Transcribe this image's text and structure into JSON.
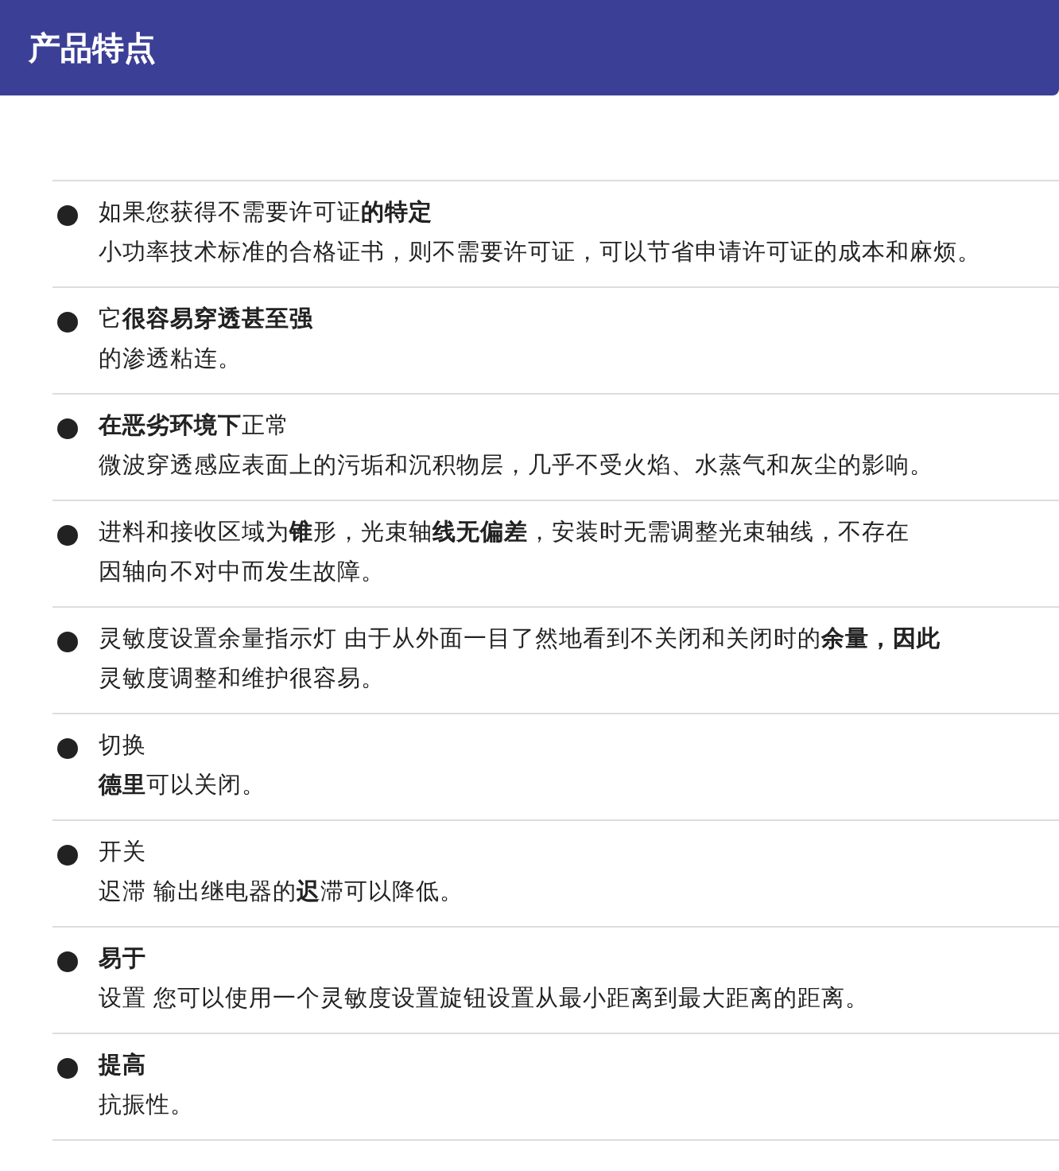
{
  "header": {
    "title": "产品特点"
  },
  "features": [
    {
      "lines": [
        "如果您获得不需要许可证**的特定**",
        "小功率技术标准的合格证书，则不需要许可证，可以节省申请许可证的成本和麻烦。"
      ]
    },
    {
      "lines": [
        "它**很容易穿透甚至强**",
        "的渗透粘连。"
      ]
    },
    {
      "lines": [
        "**在恶劣环境下**正常",
        "微波穿透感应表面上的污垢和沉积物层，几乎不受火焰、水蒸气和灰尘的影响。"
      ]
    },
    {
      "lines": [
        "进料和接收区域为**锥**形，光束轴**线无偏差**，安装时无需调整光束轴线，不存在",
        "因轴向不对中而发生故障。"
      ]
    },
    {
      "lines": [
        "灵敏度设置余量指示灯 由于从外面一目了然地看到不关闭和关闭时的**余量，因此**",
        "灵敏度调整和维护很容易。"
      ]
    },
    {
      "lines": [
        "切换",
        "**德里**可以关闭。"
      ]
    },
    {
      "lines": [
        "开关",
        "迟滞 输出继电器的**迟**滞可以降低。"
      ]
    },
    {
      "lines": [
        "**易于**",
        "设置 您可以使用一个灵敏度设置旋钮设置从最小距离到最大距离的距离。"
      ]
    },
    {
      "lines": [
        "**提高**",
        "抗振性。"
      ]
    }
  ]
}
